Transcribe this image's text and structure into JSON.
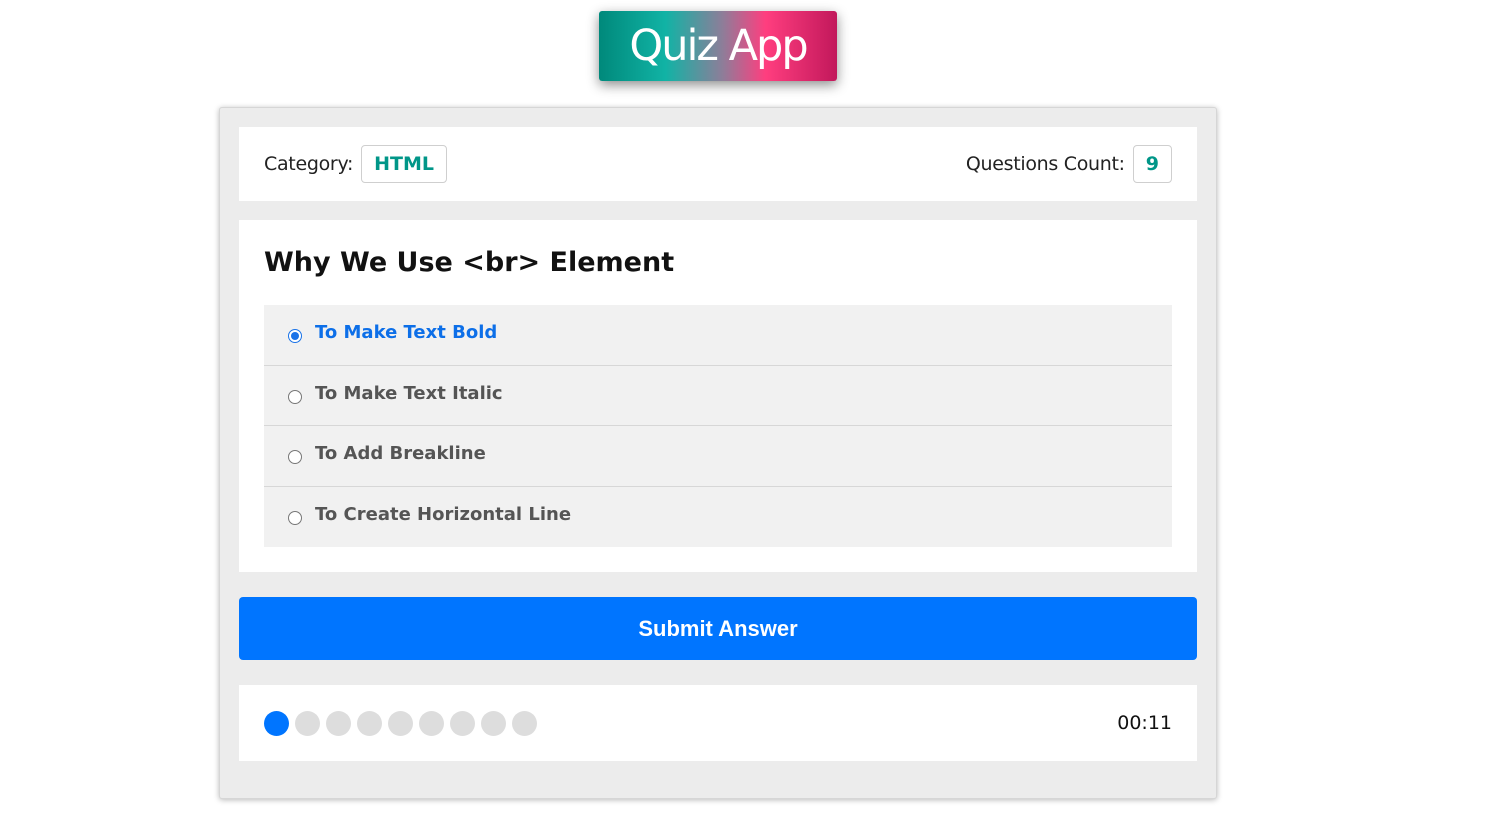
{
  "app": {
    "title": "Quiz App"
  },
  "info": {
    "category_label": "Category:",
    "category_value": "HTML",
    "count_label": "Questions Count:",
    "count_value": "9"
  },
  "question": {
    "title": "Why We Use <br> Element",
    "answers": [
      {
        "label": "To Make Text Bold",
        "selected": true
      },
      {
        "label": "To Make Text Italic",
        "selected": false
      },
      {
        "label": "To Add Breakline",
        "selected": false
      },
      {
        "label": "To Create Horizontal Line",
        "selected": false
      }
    ]
  },
  "submit": {
    "label": "Submit Answer"
  },
  "progress": {
    "total": 9,
    "current": 1
  },
  "timer": {
    "display": "00:11"
  },
  "colors": {
    "accent": "#0075ff",
    "info_value": "#009688",
    "bullet_inactive": "#dddddd"
  }
}
